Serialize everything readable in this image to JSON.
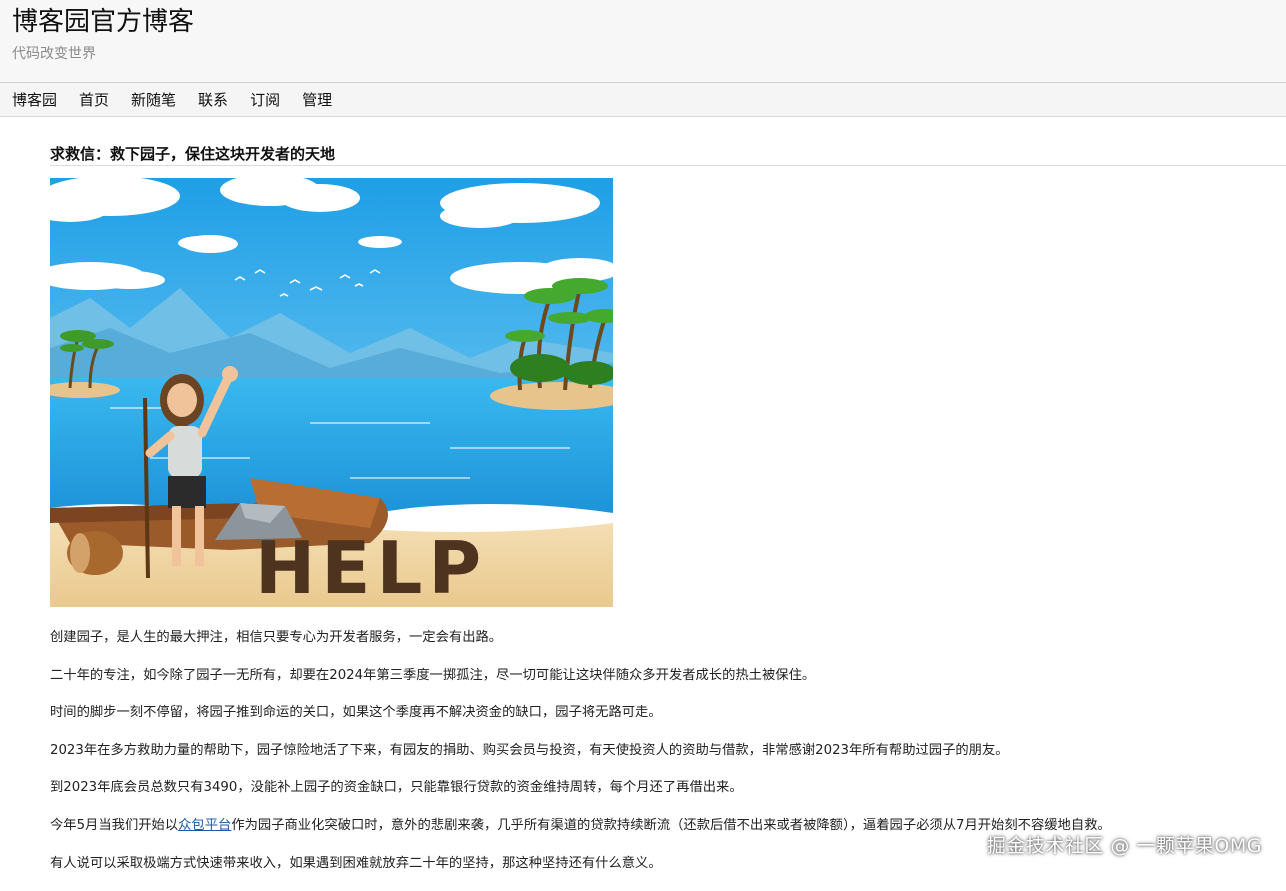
{
  "header": {
    "title": "博客园官方博客",
    "subtitle": "代码改变世界"
  },
  "nav": {
    "items": [
      "博客园",
      "首页",
      "新随笔",
      "联系",
      "订阅",
      "管理"
    ]
  },
  "post": {
    "title": "求救信：救下园子，保住这块开发者的天地",
    "image_sign_text": "HELP",
    "paragraphs": [
      "创建园子，是人生的最大押注，相信只要专心为开发者服务，一定会有出路。",
      "二十年的专注，如今除了园子一无所有，却要在2024年第三季度一掷孤注，尽一切可能让这块伴随众多开发者成长的热土被保住。",
      "时间的脚步一刻不停留，将园子推到命运的关口，如果这个季度再不解决资金的缺口，园子将无路可走。",
      "2023年在多方救助力量的帮助下，园子惊险地活了下来，有园友的捐助、购买会员与投资，有天使投资人的资助与借款，非常感谢2023年所有帮助过园子的朋友。",
      "到2023年底会员总数只有3490，没能补上园子的资金缺口，只能靠银行贷款的资金维持周转，每个月还了再借出来。"
    ],
    "p6_before": "今年5月当我们开始以",
    "p6_link": "众包平台",
    "p6_after": "作为园子商业化突破口时，意外的悲剧来袭，几乎所有渠道的贷款持续断流（还款后借不出来或者被降额），逼着园子必须从7月开始刻不容缓地自救。",
    "p7": "有人说可以采取极端方式快速带来收入，如果遇到困难就放弃二十年的坚持，那这种坚持还有什么意义。"
  },
  "watermark": "掘金技术社区 @ 一颗苹果OMG"
}
